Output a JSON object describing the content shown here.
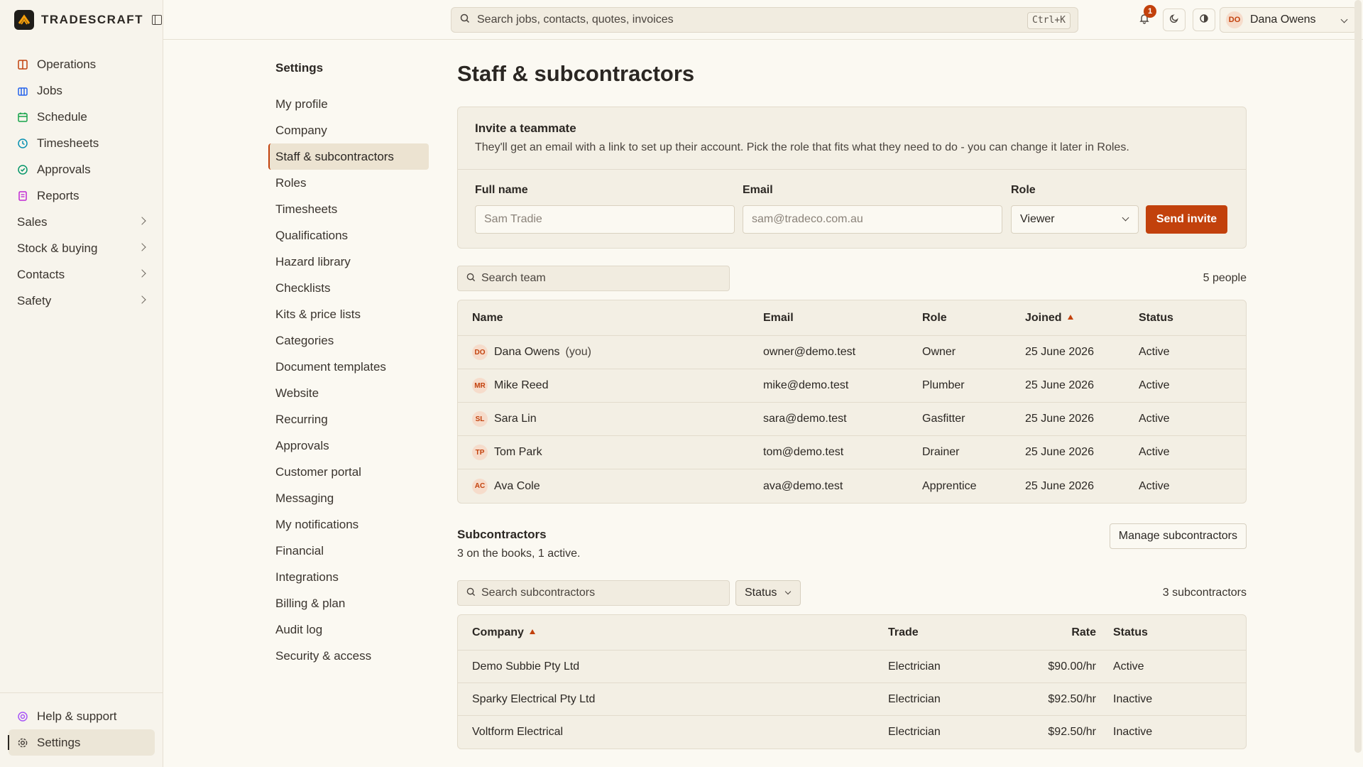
{
  "brand": {
    "name": "TRADESCRAFT"
  },
  "nav": {
    "items": [
      {
        "label": "Operations",
        "icon": "book-icon",
        "color": "#c2410c"
      },
      {
        "label": "Jobs",
        "icon": "briefcase-icon",
        "color": "#2563eb"
      },
      {
        "label": "Schedule",
        "icon": "calendar-icon",
        "color": "#16a34a"
      },
      {
        "label": "Timesheets",
        "icon": "clock-icon",
        "color": "#0891b2"
      },
      {
        "label": "Approvals",
        "icon": "check-circle-icon",
        "color": "#059669"
      },
      {
        "label": "Reports",
        "icon": "document-icon",
        "color": "#c026d3"
      },
      {
        "label": "Sales"
      },
      {
        "label": "Stock & buying"
      },
      {
        "label": "Contacts"
      },
      {
        "label": "Safety"
      }
    ],
    "bottom": [
      {
        "label": "Help & support",
        "icon": "help-icon"
      },
      {
        "label": "Settings",
        "icon": "gear-icon"
      }
    ]
  },
  "topbar": {
    "search_placeholder": "Search jobs, contacts, quotes, invoices",
    "shortcut": "Ctrl+K",
    "notifications_count": "1",
    "user": {
      "initials": "DO",
      "name": "Dana Owens"
    }
  },
  "settings_nav": {
    "title": "Settings",
    "items": [
      "My profile",
      "Company",
      "Staff & subcontractors",
      "Roles",
      "Timesheets",
      "Qualifications",
      "Hazard library",
      "Checklists",
      "Kits & price lists",
      "Categories",
      "Document templates",
      "Website",
      "Recurring",
      "Approvals",
      "Customer portal",
      "Messaging",
      "My notifications",
      "Financial",
      "Integrations",
      "Billing & plan",
      "Audit log",
      "Security & access"
    ],
    "active_index": 2
  },
  "page": {
    "title": "Staff & subcontractors"
  },
  "invite": {
    "title": "Invite a teammate",
    "description": "They'll get an email with a link to set up their account. Pick the role that fits what they need to do - you can change it later in Roles.",
    "fullname_label": "Full name",
    "fullname_placeholder": "Sam Tradie",
    "email_label": "Email",
    "email_placeholder": "sam@tradeco.com.au",
    "role_label": "Role",
    "role_value": "Viewer",
    "send_label": "Send invite"
  },
  "team": {
    "search_placeholder": "Search team",
    "count": "5 people",
    "columns": {
      "name": "Name",
      "email": "Email",
      "role": "Role",
      "joined": "Joined",
      "status": "Status"
    },
    "rows": [
      {
        "initials": "DO",
        "name": "Dana Owens",
        "you": "(you)",
        "email": "owner@demo.test",
        "role": "Owner",
        "joined": "25 June 2026",
        "status": "Active"
      },
      {
        "initials": "MR",
        "name": "Mike Reed",
        "email": "mike@demo.test",
        "role": "Plumber",
        "joined": "25 June 2026",
        "status": "Active"
      },
      {
        "initials": "SL",
        "name": "Sara Lin",
        "email": "sara@demo.test",
        "role": "Gasfitter",
        "joined": "25 June 2026",
        "status": "Active"
      },
      {
        "initials": "TP",
        "name": "Tom Park",
        "email": "tom@demo.test",
        "role": "Drainer",
        "joined": "25 June 2026",
        "status": "Active"
      },
      {
        "initials": "AC",
        "name": "Ava Cole",
        "email": "ava@demo.test",
        "role": "Apprentice",
        "joined": "25 June 2026",
        "status": "Active"
      }
    ]
  },
  "subcontractors": {
    "title": "Subcontractors",
    "description": "3 on the books, 1 active.",
    "manage_label": "Manage subcontractors",
    "search_placeholder": "Search subcontractors",
    "status_filter": "Status",
    "count": "3 subcontractors",
    "columns": {
      "company": "Company",
      "trade": "Trade",
      "rate": "Rate",
      "status": "Status"
    },
    "rows": [
      {
        "company": "Demo Subbie Pty Ltd",
        "trade": "Electrician",
        "rate": "$90.00/hr",
        "status": "Active"
      },
      {
        "company": "Sparky Electrical Pty Ltd",
        "trade": "Electrician",
        "rate": "$92.50/hr",
        "status": "Inactive"
      },
      {
        "company": "Voltform Electrical",
        "trade": "Electrician",
        "rate": "$92.50/hr",
        "status": "Inactive"
      }
    ]
  },
  "colors": {
    "accent": "#c2410c",
    "background": "#fbf9f2",
    "panel": "#f3efe4"
  }
}
